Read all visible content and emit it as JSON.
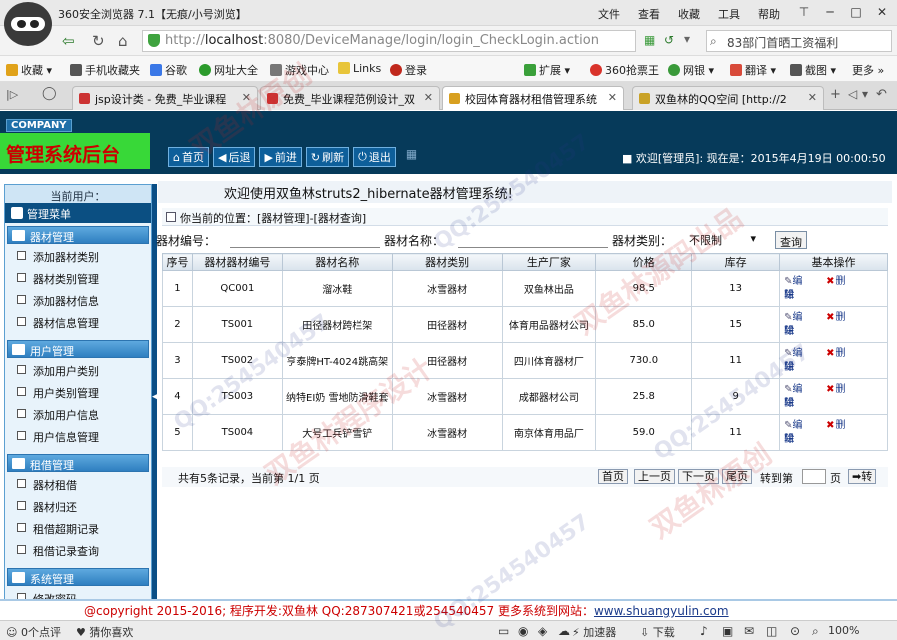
{
  "browser": {
    "title": "360安全浏览器 7.1【无痕/小号浏览】",
    "menu": [
      "文件",
      "查看",
      "收藏",
      "工具",
      "帮助"
    ],
    "url_prefix": "http://",
    "url_host": "localhost",
    "url_rest": ":8080/DeviceManage/login/login_CheckLogin.action",
    "search_text": "83部门首晒工资福利",
    "favorites": [
      {
        "label": "收藏",
        "color": "#e0a21a"
      },
      {
        "label": "手机收藏夹",
        "color": "#555555"
      },
      {
        "label": "谷歌",
        "color": "#3b78e7"
      },
      {
        "label": "网址大全",
        "color": "#2b9a2b"
      },
      {
        "label": "游戏中心",
        "color": "#777777"
      },
      {
        "label": "Links",
        "color": "#e8c53a"
      },
      {
        "label": "登录",
        "color": "#c0281c"
      }
    ],
    "right_tools": [
      {
        "label": "扩展",
        "color": "#3aa03a"
      },
      {
        "label": "360抢票王",
        "color": "#d9332b"
      },
      {
        "label": "网银",
        "color": "#3a9a3a"
      },
      {
        "label": "翻译",
        "color": "#d84a3a"
      },
      {
        "label": "截图",
        "color": "#555555"
      },
      {
        "label": "更多",
        "color": "#888888"
      }
    ],
    "tabs": [
      {
        "label": "jsp设计类 - 免费_毕业课程",
        "active": false
      },
      {
        "label": "免费_毕业课程范例设计_双",
        "active": false
      },
      {
        "label": "校园体育器材租借管理系统",
        "active": true
      },
      {
        "label": "双鱼林的QQ空间 [http://2",
        "active": false
      }
    ]
  },
  "header": {
    "company": "COMPANY",
    "title": "管理系统后台",
    "buttons": [
      "首页",
      "后退",
      "前进",
      "刷新",
      "退出"
    ],
    "welcome": "■ 欢迎[管理员]:    现在是：2015年4月19日 00:00:50"
  },
  "sidebar": {
    "current_user": "当前用户：",
    "menu_title": "管理菜单",
    "groups": [
      {
        "label": "器材管理",
        "items": [
          "添加器材类别",
          "器材类别管理",
          "添加器材信息",
          "器材信息管理"
        ]
      },
      {
        "label": "用户管理",
        "items": [
          "添加用户类别",
          "用户类别管理",
          "添加用户信息",
          "用户信息管理"
        ]
      },
      {
        "label": "租借管理",
        "items": [
          "器材租借",
          "器材归还",
          "租借超期记录",
          "租借记录查询"
        ]
      },
      {
        "label": "系统管理",
        "items": [
          "修改密码"
        ]
      }
    ]
  },
  "content": {
    "welcome": "欢迎使用双鱼林struts2_hibernate器材管理系统!",
    "location": "你当前的位置：[器材管理]-[器材查询]",
    "search": {
      "id_label": "器材编号：",
      "name_label": "器材名称：",
      "type_label": "器材类别：",
      "type_value": "不限制",
      "query_button": "查询"
    },
    "columns": [
      "序号",
      "器材器材编号",
      "器材名称",
      "器材类别",
      "生产厂家",
      "价格",
      "库存",
      "基本操作"
    ],
    "rows": [
      {
        "no": "1",
        "code": "QC001",
        "name": "溜冰鞋",
        "type": "冰雪器材",
        "maker": "双鱼林出品",
        "price": "98.5",
        "stock": "13"
      },
      {
        "no": "2",
        "code": "TS001",
        "name": "田径器材跨栏架",
        "type": "田径器材",
        "maker": "体育用品器材公司",
        "price": "85.0",
        "stock": "15"
      },
      {
        "no": "3",
        "code": "TS002",
        "name": "亨泰牌HT-4024跳高架",
        "type": "田径器材",
        "maker": "四川体育器材厂",
        "price": "730.0",
        "stock": "11"
      },
      {
        "no": "4",
        "code": "TS003",
        "name": "纳特EI奶 雪地防滑鞋套",
        "type": "冰雪器材",
        "maker": "成都器材公司",
        "price": "25.8",
        "stock": "9"
      },
      {
        "no": "5",
        "code": "TS004",
        "name": "大号工兵铲雪铲",
        "type": "冰雪器材",
        "maker": "南京体育用品厂",
        "price": "59.0",
        "stock": "11"
      }
    ],
    "op_edit": "编辑",
    "op_delete_a": "删",
    "op_delete_b": "除",
    "pager": {
      "info": "共有5条记录，当前第 1/1 页",
      "first": "首页",
      "prev": "上一页",
      "next": "下一页",
      "last": "尾页",
      "goto_label": "转到第",
      "page_unit": "页",
      "go": "➡转"
    }
  },
  "footer": {
    "copyright": "@copyright 2015-2016; 程序开发:双鱼林  QQ:287307421或254540457  更多系统到网站：",
    "url": "www.shuangyulin.com"
  },
  "statusbar": {
    "comments": "0个点评",
    "guess": "猜你喜欢",
    "accelerator": "加速器",
    "download": "下载",
    "zoom": "100%"
  },
  "watermark": {
    "line_a": "双鱼林原创",
    "line_b": "QQ:254540457",
    "line_c": "双鱼林源码出品",
    "line_d": "双鱼林程序设计"
  }
}
